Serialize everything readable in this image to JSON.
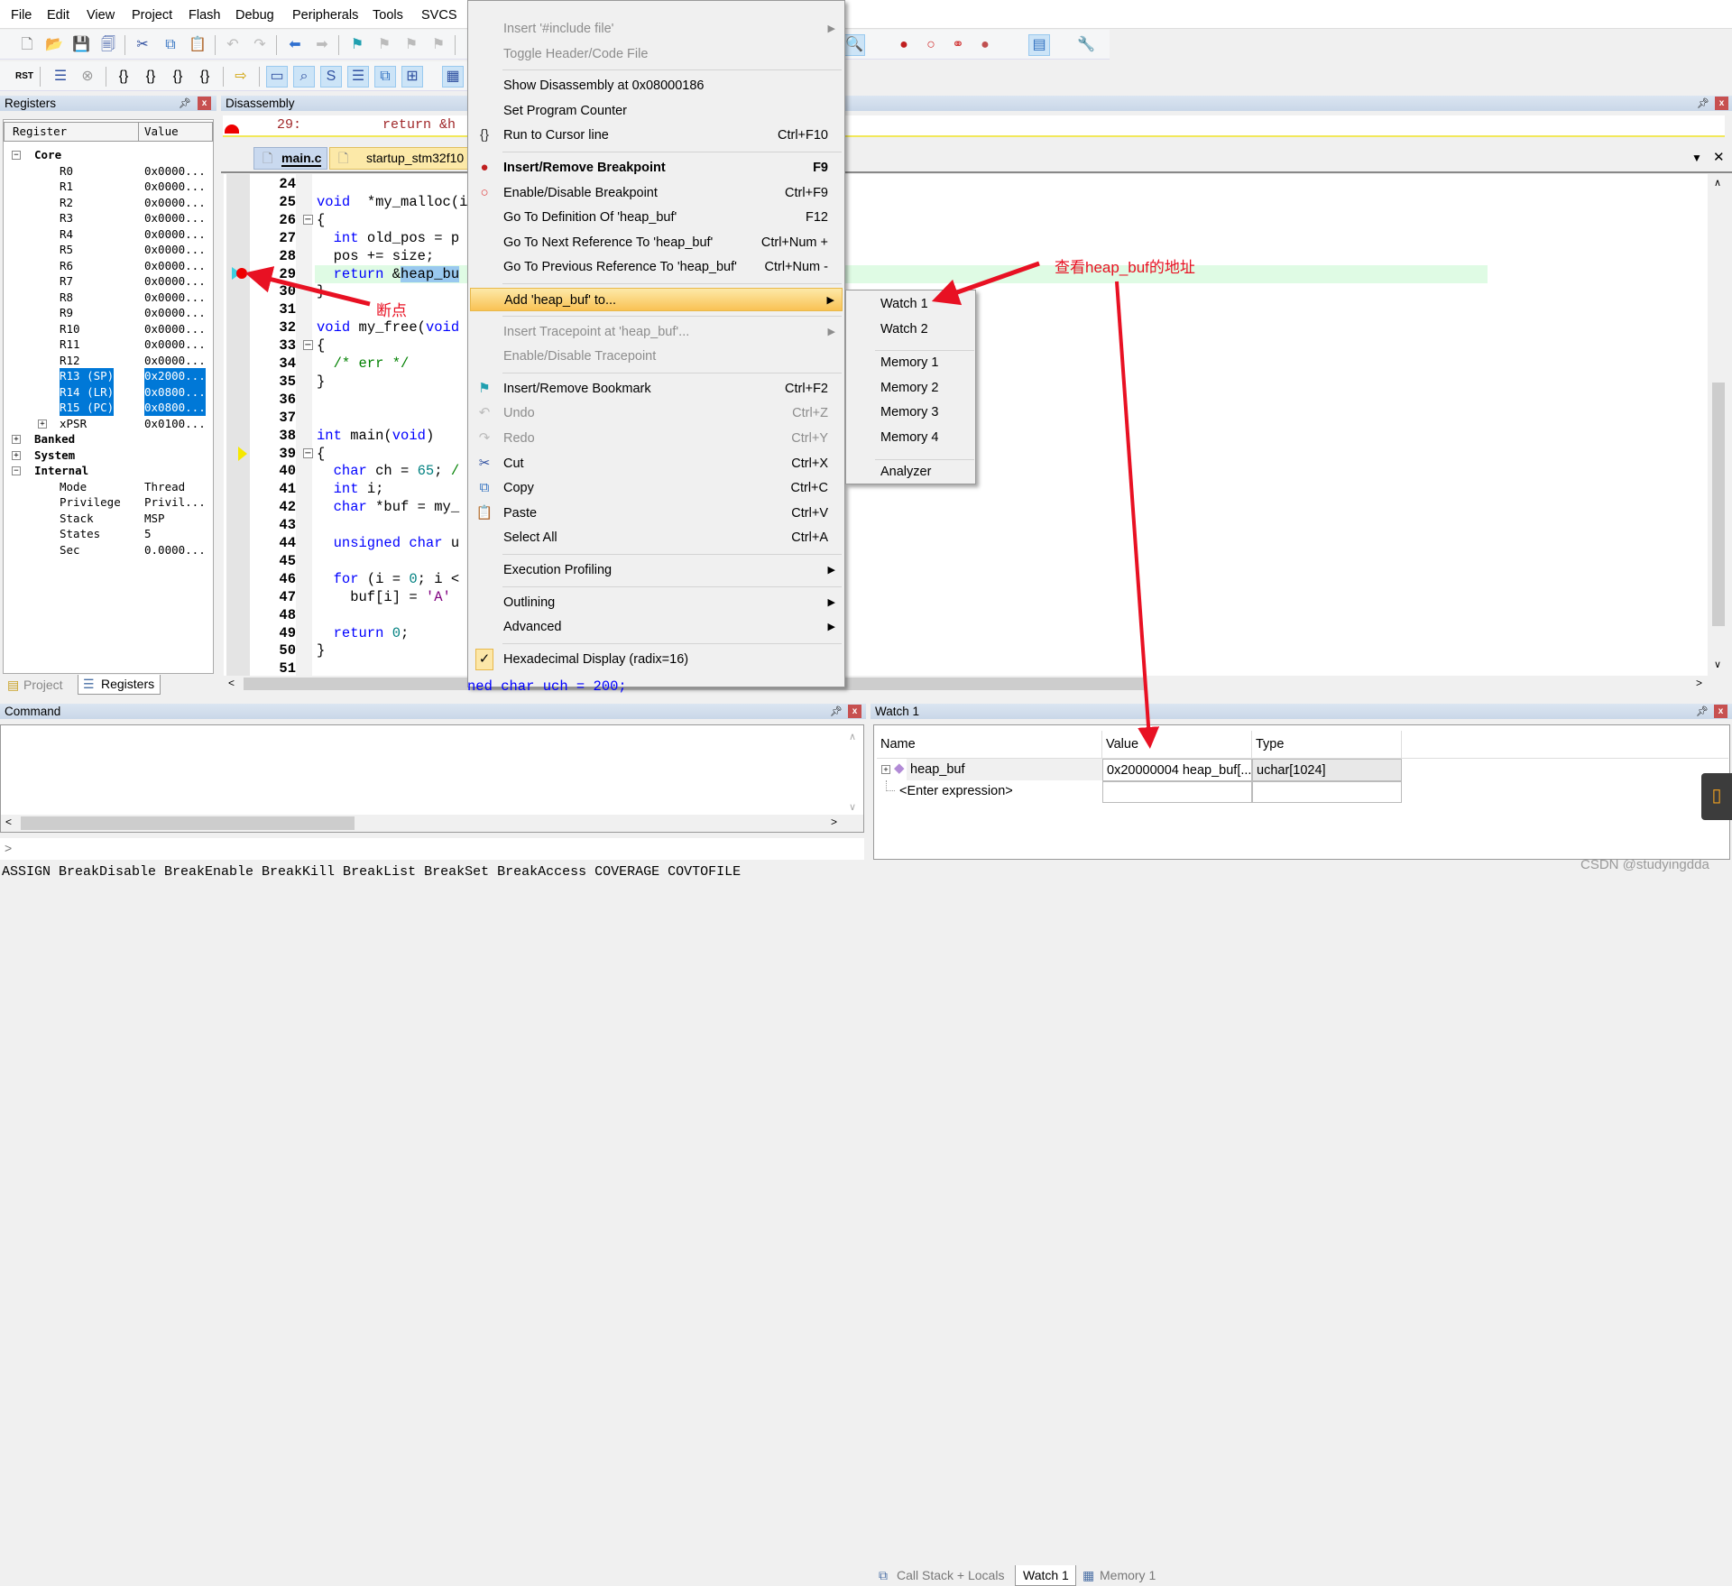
{
  "menubar": [
    "File",
    "Edit",
    "View",
    "Project",
    "Flash",
    "Debug",
    "Peripherals",
    "Tools",
    "SVCS"
  ],
  "toolbar1": [
    "new-file",
    "open-file",
    "save",
    "save-all",
    "cut",
    "copy",
    "paste",
    "undo",
    "redo",
    "nav-back",
    "nav-forward",
    "bookmark",
    "prev-bookmark",
    "next-bookmark",
    "clear-bookmarks",
    "find-in-files",
    "breakpoint-insert",
    "breakpoint-enable",
    "breakpoint-disable-all",
    "breakpoint-kill-all",
    "window-layout",
    "configure"
  ],
  "toolbar2": [
    "reset",
    "run",
    "stop",
    "step-into",
    "step-over",
    "step-out",
    "run-to-cursor",
    "show-next-statement",
    "command-window",
    "disassembly-window",
    "symbols-window",
    "registers-window",
    "call-stack-window",
    "watch-window",
    "memory-window"
  ],
  "registers": {
    "title": "Registers",
    "col_register": "Register",
    "col_value": "Value",
    "rows": [
      {
        "name": "Core",
        "value": "",
        "level": 0,
        "toggle": "-",
        "bold": true
      },
      {
        "name": "R0",
        "value": "0x0000...",
        "level": 1
      },
      {
        "name": "R1",
        "value": "0x0000...",
        "level": 1
      },
      {
        "name": "R2",
        "value": "0x0000...",
        "level": 1
      },
      {
        "name": "R3",
        "value": "0x0000...",
        "level": 1
      },
      {
        "name": "R4",
        "value": "0x0000...",
        "level": 1
      },
      {
        "name": "R5",
        "value": "0x0000...",
        "level": 1
      },
      {
        "name": "R6",
        "value": "0x0000...",
        "level": 1
      },
      {
        "name": "R7",
        "value": "0x0000...",
        "level": 1
      },
      {
        "name": "R8",
        "value": "0x0000...",
        "level": 1
      },
      {
        "name": "R9",
        "value": "0x0000...",
        "level": 1
      },
      {
        "name": "R10",
        "value": "0x0000...",
        "level": 1
      },
      {
        "name": "R11",
        "value": "0x0000...",
        "level": 1
      },
      {
        "name": "R12",
        "value": "0x0000...",
        "level": 1
      },
      {
        "name": "R13 (SP)",
        "value": "0x2000...",
        "level": 1,
        "selected": true
      },
      {
        "name": "R14 (LR)",
        "value": "0x0800...",
        "level": 1,
        "selected": true
      },
      {
        "name": "R15 (PC)",
        "value": "0x0800...",
        "level": 1,
        "selected": true
      },
      {
        "name": "xPSR",
        "value": "0x0100...",
        "level": 1,
        "toggle": "+"
      },
      {
        "name": "Banked",
        "value": "",
        "level": 0,
        "toggle": "+"
      },
      {
        "name": "System",
        "value": "",
        "level": 0,
        "toggle": "+"
      },
      {
        "name": "Internal",
        "value": "",
        "level": 0,
        "toggle": "-"
      },
      {
        "name": "Mode",
        "value": "Thread",
        "level": 1
      },
      {
        "name": "Privilege",
        "value": "Privil...",
        "level": 1
      },
      {
        "name": "Stack",
        "value": "MSP",
        "level": 1
      },
      {
        "name": "States",
        "value": "5",
        "level": 1
      },
      {
        "name": "Sec",
        "value": "0.0000...",
        "level": 1
      }
    ],
    "tabs": [
      "Project",
      "Registers"
    ]
  },
  "disassembly": {
    "title": "Disassembly",
    "line": "29:          return &h"
  },
  "editor": {
    "tabs": [
      "main.c",
      "startup_stm32f10"
    ],
    "lines": [
      {
        "n": "24",
        "t": []
      },
      {
        "n": "25",
        "t": [
          [
            "kw",
            "void"
          ],
          [
            "",
            "  *my_malloc(i"
          ]
        ]
      },
      {
        "n": "26",
        "t": [
          [
            "",
            "{"
          ]
        ],
        "fold": true
      },
      {
        "n": "27",
        "t": [
          [
            "kw",
            "  int"
          ],
          [
            "",
            " old_pos = p"
          ]
        ]
      },
      {
        "n": "28",
        "t": [
          [
            "",
            "  pos += size;"
          ]
        ]
      },
      {
        "n": "29",
        "t": [
          [
            "kw",
            "  return"
          ],
          [
            "",
            " &"
          ],
          [
            "hl",
            "heap_bu"
          ]
        ],
        "current": true
      },
      {
        "n": "30",
        "t": [
          [
            "",
            "}"
          ]
        ]
      },
      {
        "n": "31",
        "t": []
      },
      {
        "n": "32",
        "t": [
          [
            "kw",
            "void"
          ],
          [
            "",
            " my_free("
          ],
          [
            "kw",
            "void"
          ]
        ]
      },
      {
        "n": "33",
        "t": [
          [
            "",
            "{"
          ]
        ],
        "fold": true
      },
      {
        "n": "34",
        "t": [
          [
            "cm",
            "  /* err */"
          ]
        ]
      },
      {
        "n": "35",
        "t": [
          [
            "",
            "}"
          ]
        ]
      },
      {
        "n": "36",
        "t": []
      },
      {
        "n": "37",
        "t": []
      },
      {
        "n": "38",
        "t": [
          [
            "kw",
            "int"
          ],
          [
            "",
            " main("
          ],
          [
            "kw",
            "void"
          ],
          [
            "",
            ")"
          ]
        ]
      },
      {
        "n": "39",
        "t": [
          [
            "",
            "{"
          ]
        ],
        "fold": true
      },
      {
        "n": "40",
        "t": [
          [
            "kw",
            "  char"
          ],
          [
            "",
            " ch = "
          ],
          [
            "num",
            "65"
          ],
          [
            "",
            "; "
          ],
          [
            "cm",
            "/"
          ]
        ]
      },
      {
        "n": "41",
        "t": [
          [
            "kw",
            "  int"
          ],
          [
            "",
            " i;"
          ]
        ]
      },
      {
        "n": "42",
        "t": [
          [
            "kw",
            "  char"
          ],
          [
            "",
            " *buf = my_"
          ]
        ]
      },
      {
        "n": "43",
        "t": []
      },
      {
        "n": "44",
        "t": [
          [
            "kw",
            "  unsigned char"
          ],
          [
            "",
            " u"
          ]
        ]
      },
      {
        "n": "45",
        "t": []
      },
      {
        "n": "46",
        "t": [
          [
            "kw",
            "  for"
          ],
          [
            "",
            " (i = "
          ],
          [
            "num",
            "0"
          ],
          [
            "",
            "; i <"
          ]
        ]
      },
      {
        "n": "47",
        "t": [
          [
            "",
            "    buf[i] = "
          ],
          [
            "str",
            "'A'"
          ]
        ]
      },
      {
        "n": "48",
        "t": []
      },
      {
        "n": "49",
        "t": [
          [
            "kw",
            "  return"
          ],
          [
            "",
            " "
          ],
          [
            "num",
            "0"
          ],
          [
            "",
            ";"
          ]
        ]
      },
      {
        "n": "50",
        "t": [
          [
            "",
            "}"
          ]
        ]
      },
      {
        "n": "51",
        "t": []
      }
    ],
    "peek_line": "ned char uch = 200;"
  },
  "context_menu": [
    {
      "label": "Insert '#include file'",
      "disabled": true,
      "submenu": true
    },
    {
      "label": "Toggle Header/Code File",
      "disabled": true
    },
    {
      "sep": true
    },
    {
      "label": "Show Disassembly at 0x08000186"
    },
    {
      "label": "Set Program Counter"
    },
    {
      "label": "Run to Cursor line",
      "shortcut": "Ctrl+F10",
      "icon": "run-to-cursor-icon"
    },
    {
      "sep": true
    },
    {
      "label": "Insert/Remove Breakpoint",
      "shortcut": "F9",
      "icon": "breakpoint-icon",
      "bold": true
    },
    {
      "label": "Enable/Disable Breakpoint",
      "shortcut": "Ctrl+F9",
      "icon": "breakpoint-outline-icon"
    },
    {
      "label": "Go To Definition Of 'heap_buf'",
      "shortcut": "F12"
    },
    {
      "label": "Go To Next Reference To 'heap_buf'",
      "shortcut": "Ctrl+Num +"
    },
    {
      "label": "Go To Previous Reference To 'heap_buf'",
      "shortcut": "Ctrl+Num -"
    },
    {
      "sep": true
    },
    {
      "label": "Add 'heap_buf' to...",
      "submenu": true,
      "highlighted": true
    },
    {
      "sep": true
    },
    {
      "label": "Insert Tracepoint at 'heap_buf'...",
      "disabled": true,
      "submenu": true
    },
    {
      "label": "Enable/Disable Tracepoint",
      "disabled": true
    },
    {
      "sep": true
    },
    {
      "label": "Insert/Remove Bookmark",
      "shortcut": "Ctrl+F2",
      "icon": "bookmark-icon"
    },
    {
      "label": "Undo",
      "shortcut": "Ctrl+Z",
      "disabled": true,
      "icon": "undo-icon"
    },
    {
      "label": "Redo",
      "shortcut": "Ctrl+Y",
      "disabled": true,
      "icon": "redo-icon"
    },
    {
      "label": "Cut",
      "shortcut": "Ctrl+X",
      "icon": "scissors-icon"
    },
    {
      "label": "Copy",
      "shortcut": "Ctrl+C",
      "icon": "copy-icon"
    },
    {
      "label": "Paste",
      "shortcut": "Ctrl+V",
      "icon": "paste-icon"
    },
    {
      "label": "Select All",
      "shortcut": "Ctrl+A"
    },
    {
      "sep": true
    },
    {
      "label": "Execution Profiling",
      "submenu": true
    },
    {
      "sep": true
    },
    {
      "label": "Outlining",
      "submenu": true
    },
    {
      "label": "Advanced",
      "submenu": true
    },
    {
      "sep": true
    },
    {
      "label": "Hexadecimal Display (radix=16)",
      "icon": "checkmark-icon",
      "checked": true
    }
  ],
  "submenu": [
    {
      "label": "Watch 1"
    },
    {
      "label": "Watch 2"
    },
    {
      "sep": true
    },
    {
      "label": "Memory 1"
    },
    {
      "label": "Memory 2"
    },
    {
      "label": "Memory 3"
    },
    {
      "label": "Memory 4"
    },
    {
      "sep": true
    },
    {
      "label": "Analyzer"
    }
  ],
  "annotations": {
    "breakpoint": "断点",
    "watch_hint": "查看heap_buf的地址",
    "color": "#e81123"
  },
  "command": {
    "title": "Command",
    "prompt": ">",
    "hints": "ASSIGN BreakDisable BreakEnable BreakKill BreakList BreakSet BreakAccess COVERAGE COVTOFILE"
  },
  "watch": {
    "title": "Watch 1",
    "columns": [
      "Name",
      "Value",
      "Type"
    ],
    "rows": [
      {
        "name": "heap_buf",
        "value": "0x20000004 heap_buf[...",
        "type": "uchar[1024]"
      }
    ],
    "enter_expression": "<Enter expression>",
    "tabs": [
      "Call Stack + Locals",
      "Watch 1",
      "Memory 1"
    ]
  },
  "watermark": "CSDN @studyingdda"
}
